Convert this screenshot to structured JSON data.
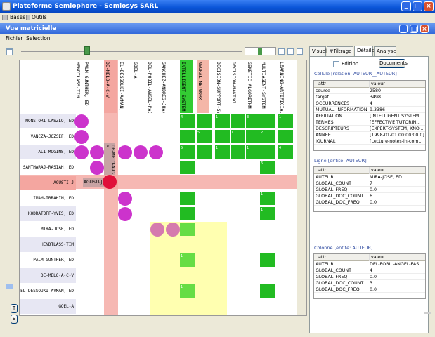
{
  "window": {
    "title": "Plateforme Semiophore - Semiosys SARL"
  },
  "menubar": {
    "items": [
      "Bases",
      "Outils"
    ]
  },
  "subwindow": {
    "title": "Vue matricielle"
  },
  "submenu": {
    "items": [
      "Fichier",
      "Selection"
    ]
  },
  "sidebar_buttons": [
    "T",
    "E"
  ],
  "columns": [
    "HENDTLASS-TIM",
    "PALM-GUNTHER, ED",
    "DE-MELO-A-C-V",
    "EL-DESSOUKI-AYMAN, E",
    "GOEL-A",
    "DEL-POBIL-ANGEL-PASQ",
    "SANCHEZ-ANDRES-JUAN",
    "INTELLIGENT-SYSTEM",
    "NEURAL-NETWORK",
    "DECISION-SUPPORT-SYS",
    "DECISION-MAKING",
    "GENETIC-ALGORITHM",
    "MULTIAGENT-SYSTEM",
    "LEARNING-ARTIFICIAL-I"
  ],
  "rows": [
    "MONSTORI-LASZLO, ED",
    "VANCZA-JOZSEF, ED",
    "ALI-MOGINS, ED",
    "SANTHARAJ-RASIAH, ED",
    "AGUSTI-J",
    "IMAM-IBRAHIM, ED",
    "KODRATOFF-YVES, ED",
    "MIRA-JOSE, ED",
    "HENDTLASS-TIM",
    "PALM-GUNTHER, ED",
    "DE-MELO-A-C-V",
    "EL-DESSOUKI-AYMAN, ED",
    "GOEL-A"
  ],
  "highlight_labels": {
    "row_cell": "AGUSTI-J",
    "col_cell": "DE-MELO-A-C-V"
  },
  "cell_marks": [
    "4",
    "1",
    "3",
    "1",
    "5",
    "1",
    "2",
    "5",
    "1",
    "1",
    "4",
    "6",
    "1",
    "1",
    "1",
    "1",
    "1",
    "1",
    "1",
    "1",
    "1",
    "1"
  ],
  "tabs": [
    "Visuel",
    "Filtrage",
    "Détails",
    "Analyse"
  ],
  "selected_tab": "Détails",
  "details": {
    "edition_label": "Edition",
    "documents_button": "Documents",
    "cell_title": "Cellule [relation: AUTEUR__AUTEUR]",
    "cell_headers": [
      "attr",
      "valeur"
    ],
    "cell_rows": [
      [
        "source",
        "2580"
      ],
      [
        "target",
        "3498"
      ],
      [
        "OCCURRENCES",
        "4"
      ],
      [
        "MUTUAL_INFORMATION",
        "9.3386"
      ],
      [
        "AFFILIATION",
        "[INTELLIGENT SYSTEM..."
      ],
      [
        "TERMES",
        "[EFFECTIVE TUTORIN..."
      ],
      [
        "DESCRIPTEURS",
        "[EXPERT-SYSTEM, KNO..."
      ],
      [
        "ANNEE",
        "[1998-01-01 00:00:00.0]"
      ],
      [
        "JOURNAL",
        "[Lecture-notes-in-com..."
      ]
    ],
    "row_title": "Ligne [entité: AUTEUR]",
    "row_headers": [
      "attr",
      "valeur"
    ],
    "row_rows": [
      [
        "AUTEUR",
        "MIRA-JOSE, ED"
      ],
      [
        "GLOBAL_COUNT",
        "7"
      ],
      [
        "GLOBAL_FREQ",
        "0.0"
      ],
      [
        "GLOBAL_DOC_COUNT",
        "6"
      ],
      [
        "GLOBAL_DOC_FREQ",
        "0.0"
      ]
    ],
    "col_title": "Colonne [entité: AUTEUR]",
    "col_headers": [
      "attr",
      "valeur"
    ],
    "col_rows": [
      [
        "AUTEUR",
        "DEL-POBIL-ANGEL-PAS..."
      ],
      [
        "GLOBAL_COUNT",
        "4"
      ],
      [
        "GLOBAL_FREQ",
        "0.0"
      ],
      [
        "GLOBAL_DOC_COUNT",
        "3"
      ],
      [
        "GLOBAL_DOC_FREQ",
        "0.0"
      ]
    ]
  },
  "colors": {
    "titlebar": "#0A55D8",
    "green": "#22BB22",
    "magenta": "#CC33CC",
    "highlight": "#F4A6A0",
    "yellow": "#FFFFB0"
  }
}
